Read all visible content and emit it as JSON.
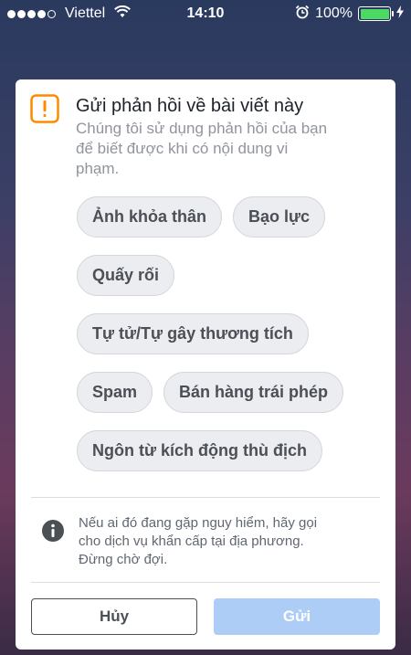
{
  "status_bar": {
    "carrier": "Viettel",
    "time": "14:10",
    "battery": "100%",
    "battery_level": 1.0
  },
  "dialog": {
    "title": "Gửi phản hồi về bài viết này",
    "subtitle_lines": [
      "Chúng tôi sử dụng phản hồi của bạn",
      "để biết được khi có nội dung vi",
      "phạm."
    ],
    "options": [
      [
        "Ảnh khỏa thân",
        "Bạo lực"
      ],
      [
        "Quấy rối"
      ],
      [
        "Tự tử/Tự gây thương tích"
      ],
      [
        "Spam",
        "Bán hàng trái phép"
      ],
      [
        "Ngôn từ kích động thù địch"
      ]
    ],
    "info_lines": [
      "Nếu ai đó đang gặp nguy hiểm, hãy gọi",
      "cho dịch vụ khẩn cấp tại địa phương.",
      "Đừng chờ đợi."
    ],
    "cancel_label": "Hủy",
    "send_label": "Gửi"
  },
  "colors": {
    "warning": "#ff8a00",
    "send_disabled": "#adcdf6",
    "battery": "#4cd964"
  }
}
